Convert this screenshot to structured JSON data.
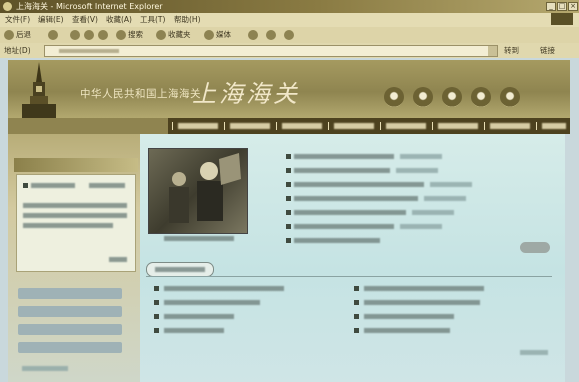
{
  "window": {
    "title": "上海海关 - Microsoft Internet Explorer",
    "controls": [
      "_",
      "□",
      "×"
    ]
  },
  "menu": [
    "文件(F)",
    "编辑(E)",
    "查看(V)",
    "收藏(A)",
    "工具(T)",
    "帮助(H)"
  ],
  "toolbar": {
    "back": "后退",
    "search": "搜索",
    "favorites": "收藏夹",
    "media": "媒体",
    "icons": [
      "back-icon",
      "forward-icon",
      "stop-icon",
      "refresh-icon",
      "home-icon",
      "search-icon",
      "favorites-icon",
      "media-icon",
      "history-icon",
      "mail-icon",
      "print-icon"
    ]
  },
  "address": {
    "label": "地址(D)",
    "go": "转到",
    "links": "链接"
  },
  "banner": {
    "title": "中华人民共和国上海海关",
    "calligraphy": "上海海关"
  },
  "colors": {
    "titlebar": "#5e5228",
    "banner": "#a59a60",
    "navbar": "#4d421f",
    "content": "#c5e3e3"
  }
}
